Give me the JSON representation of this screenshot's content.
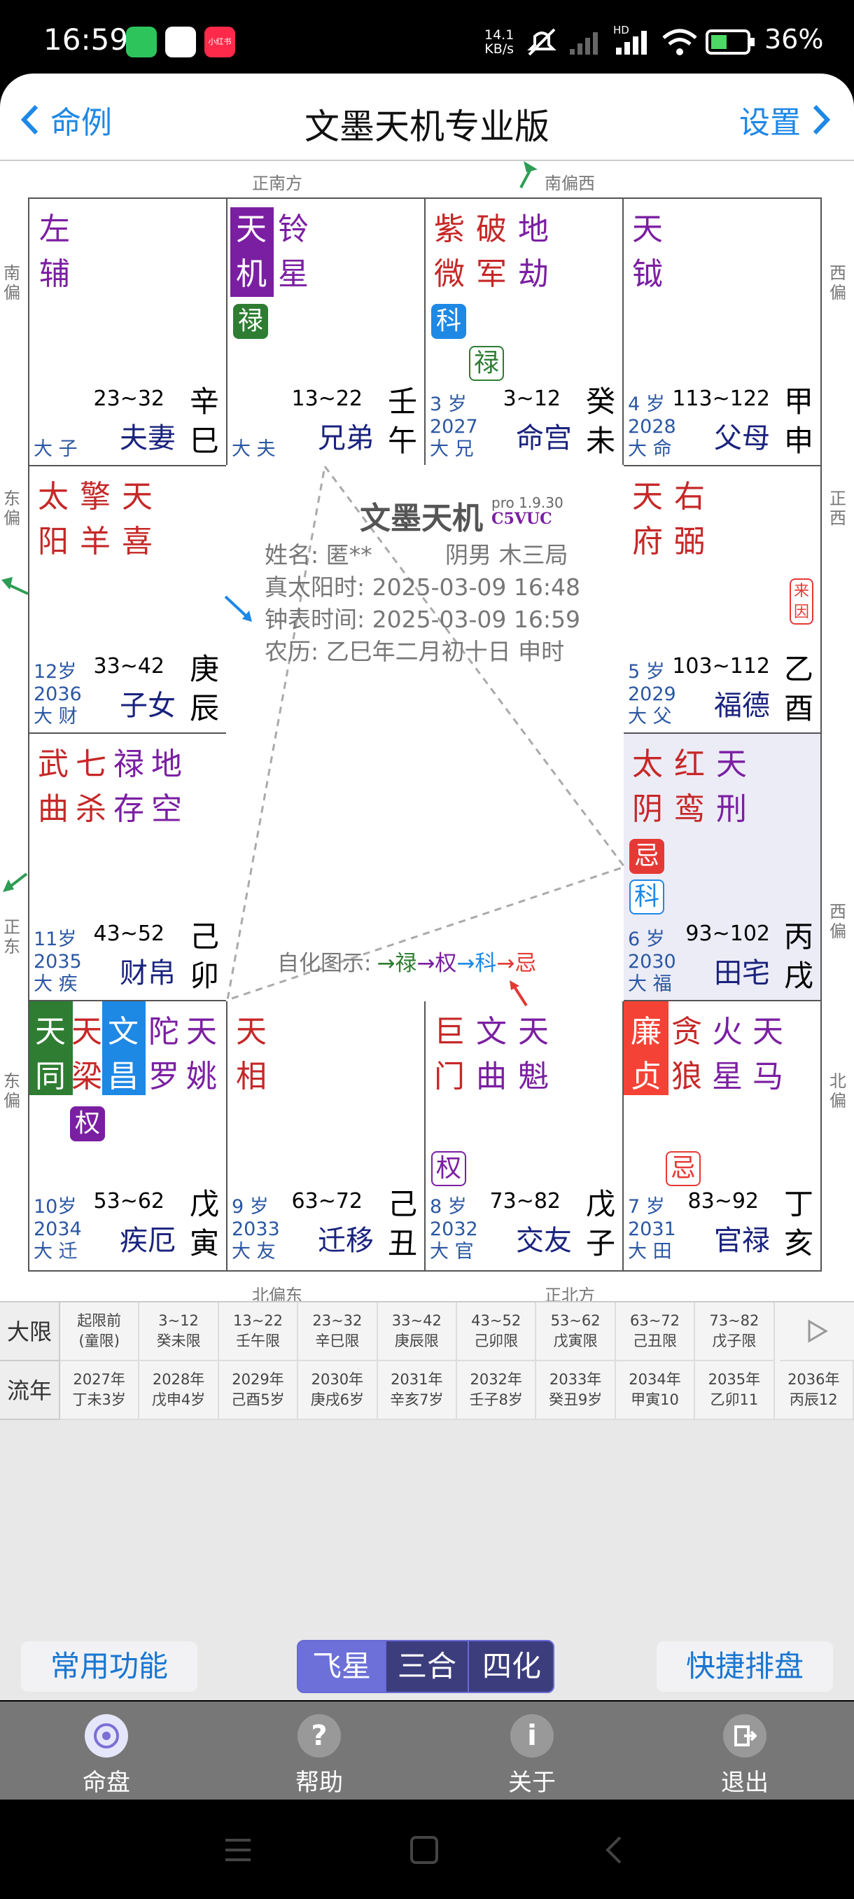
{
  "status": {
    "time": "16:59",
    "speed_top": "14.1",
    "speed_bottom": "KB/s",
    "hd": "HD",
    "battery": "36%",
    "app_icon3": "小红书"
  },
  "appbar": {
    "back_label": "命例",
    "title": "文墨天机专业版",
    "settings_label": "设置"
  },
  "directions": {
    "top_left": "正南方",
    "top_right": "南偏西",
    "bottom_left": "北偏东",
    "bottom_right": "正北方",
    "left": [
      "南偏",
      "东偏",
      "正东",
      "东偏"
    ],
    "right": [
      "西偏",
      "正西",
      "西偏",
      "北偏"
    ]
  },
  "palaces": {
    "sizi": {
      "stars": [
        "左",
        "辅"
      ],
      "range": "23~32",
      "name": "夫妻",
      "stem": "辛",
      "branch": "巳",
      "small": "大 子"
    },
    "wu": {
      "range": "13~22",
      "name": "兄弟",
      "stem": "壬",
      "branch": "午",
      "small": "大 夫",
      "col1": [
        "天",
        "机"
      ],
      "col2": [
        "铃",
        "星"
      ],
      "tag": "禄"
    },
    "wei": {
      "age": "3 岁",
      "year": "2027",
      "small": "大 兄",
      "range": "3~12",
      "name": "命宫",
      "stem": "癸",
      "branch": "未",
      "col1": [
        "紫",
        "微"
      ],
      "col2": [
        "破",
        "军"
      ],
      "col3": [
        "地",
        "劫"
      ],
      "tag1": "科",
      "tag2": "禄"
    },
    "shen": {
      "age": "4 岁",
      "year": "2028",
      "small": "大 命",
      "range": "113~122",
      "name": "父母",
      "stem": "甲",
      "branch": "申",
      "col1": [
        "天",
        "钺"
      ]
    },
    "chen": {
      "age": "12岁",
      "year": "2036",
      "small": "大 财",
      "range": "33~42",
      "name": "子女",
      "stem": "庚",
      "branch": "辰",
      "col1": [
        "太",
        "阳"
      ],
      "col2": [
        "擎",
        "羊"
      ],
      "col3": [
        "天",
        "喜"
      ]
    },
    "you": {
      "age": "5 岁",
      "year": "2029",
      "small": "大 父",
      "range": "103~112",
      "name": "福德",
      "stem": "乙",
      "branch": "酉",
      "col1": [
        "天",
        "府"
      ],
      "col2": [
        "右",
        "弼"
      ],
      "laiyin": "来因"
    },
    "mao": {
      "age": "11岁",
      "year": "2035",
      "small": "大 疾",
      "range": "43~52",
      "name": "财帛",
      "stem": "己",
      "branch": "卯",
      "col1": [
        "武",
        "曲"
      ],
      "col2": [
        "七",
        "杀"
      ],
      "col3": [
        "禄",
        "存"
      ],
      "col4": [
        "地",
        "空"
      ]
    },
    "xu": {
      "age": "6 岁",
      "year": "2030",
      "small": "大 福",
      "range": "93~102",
      "name": "田宅",
      "stem": "丙",
      "branch": "戌",
      "col1": [
        "太",
        "阴"
      ],
      "col2": [
        "红",
        "鸾"
      ],
      "col3": [
        "天",
        "刑"
      ],
      "tag1": "忌",
      "tag2": "科"
    },
    "yin": {
      "age": "10岁",
      "year": "2034",
      "small": "大 迁",
      "range": "53~62",
      "name": "疾厄",
      "stem": "戊",
      "branch": "寅",
      "col1": [
        "天",
        "同"
      ],
      "col2": [
        "天",
        "梁"
      ],
      "col3": [
        "文",
        "昌"
      ],
      "col4": [
        "陀",
        "罗"
      ],
      "col5": [
        "天",
        "姚"
      ],
      "tag": "权"
    },
    "chou": {
      "age": "9 岁",
      "year": "2033",
      "small": "大 友",
      "range": "63~72",
      "name": "迁移",
      "stem": "己",
      "branch": "丑",
      "col1": [
        "天",
        "相"
      ]
    },
    "zi": {
      "age": "8 岁",
      "year": "2032",
      "small": "大 官",
      "range": "73~82",
      "name": "交友",
      "stem": "戊",
      "branch": "子",
      "col1": [
        "巨",
        "门"
      ],
      "col2": [
        "文",
        "曲"
      ],
      "col3": [
        "天",
        "魁"
      ],
      "tag": "权"
    },
    "hai": {
      "age": "7 岁",
      "year": "2031",
      "small": "大 田",
      "range": "83~92",
      "name": "官禄",
      "stem": "丁",
      "branch": "亥",
      "col1": [
        "廉",
        "贞"
      ],
      "col2": [
        "贪",
        "狼"
      ],
      "col3": [
        "火",
        "星"
      ],
      "col4": [
        "天",
        "马"
      ],
      "tag": "忌"
    }
  },
  "center": {
    "logo": "文墨天机",
    "version": "pro 1.9.30",
    "code": "C5VUC",
    "name_line": "姓名: 匿**",
    "gender": "阴男 木三局",
    "solar": "真太阳时: 2025-03-09 16:48",
    "clock": "钟表时间: 2025-03-09 16:59",
    "lunar": "农历: 乙巳年二月初十日 申时",
    "legend_label": "自化图示:",
    "legend_lu": "→禄",
    "legend_quan": "→权",
    "legend_ke": "→科",
    "legend_ji": "→忌"
  },
  "table": {
    "daxian_label": "大限",
    "liunian_label": "流年",
    "daxian": [
      [
        "起限前",
        "(童限)"
      ],
      [
        "3~12",
        "癸未限"
      ],
      [
        "13~22",
        "壬午限"
      ],
      [
        "23~32",
        "辛巳限"
      ],
      [
        "33~42",
        "庚辰限"
      ],
      [
        "43~52",
        "己卯限"
      ],
      [
        "53~62",
        "戊寅限"
      ],
      [
        "63~72",
        "己丑限"
      ],
      [
        "73~82",
        "戊子限"
      ]
    ],
    "liunian": [
      [
        "2027年",
        "丁未3岁"
      ],
      [
        "2028年",
        "戊申4岁"
      ],
      [
        "2029年",
        "己酉5岁"
      ],
      [
        "2030年",
        "庚戌6岁"
      ],
      [
        "2031年",
        "辛亥7岁"
      ],
      [
        "2032年",
        "壬子8岁"
      ],
      [
        "2033年",
        "癸丑9岁"
      ],
      [
        "2034年",
        "甲寅10"
      ],
      [
        "2035年",
        "乙卯11"
      ],
      [
        "2036年",
        "丙辰12"
      ]
    ],
    "next_icon": "play-icon"
  },
  "buttons": {
    "common": "常用功能",
    "quick": "快捷排盘",
    "seg1": "飞星",
    "seg2": "三合",
    "seg3": "四化"
  },
  "nav": {
    "item1": "命盘",
    "item2": "帮助",
    "item3": "关于",
    "item4": "退出"
  },
  "colors": {
    "purple": "#7b1fa2",
    "red": "#c62828",
    "green": "#2e7d32",
    "blue": "#1e88e5",
    "accent": "#1976d2"
  }
}
